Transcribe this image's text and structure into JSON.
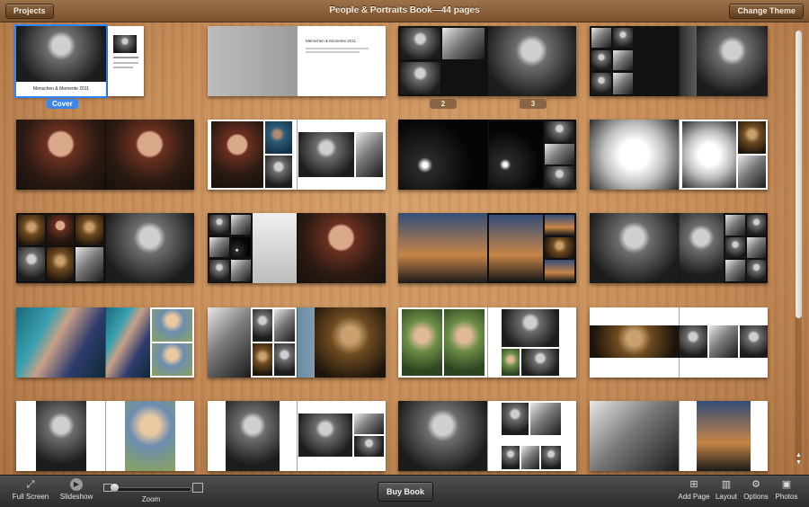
{
  "window": {
    "title": "People & Portraits Book—44 pages",
    "projects_label": "Projects",
    "change_theme_label": "Change Theme"
  },
  "cover": {
    "caption": "Menschen & Momente 2011",
    "label": "Cover"
  },
  "intro_page": {
    "title": "Menschen & Momente 2011"
  },
  "page_labels": [
    "2",
    "3"
  ],
  "toolbar": {
    "full_screen": "Full Screen",
    "slideshow": "Slideshow",
    "zoom": "Zoom",
    "buy_book": "Buy Book",
    "add_page": "Add Page",
    "layout": "Layout",
    "options": "Options",
    "photos": "Photos"
  },
  "icons": {
    "full_screen": "full-screen-icon",
    "slideshow": "play-icon",
    "add_page": "add-page-icon",
    "layout": "layout-icon",
    "options": "options-icon",
    "photos": "photos-icon"
  },
  "colors": {
    "selection": "#2f86ff",
    "wood": "#c48a55"
  }
}
